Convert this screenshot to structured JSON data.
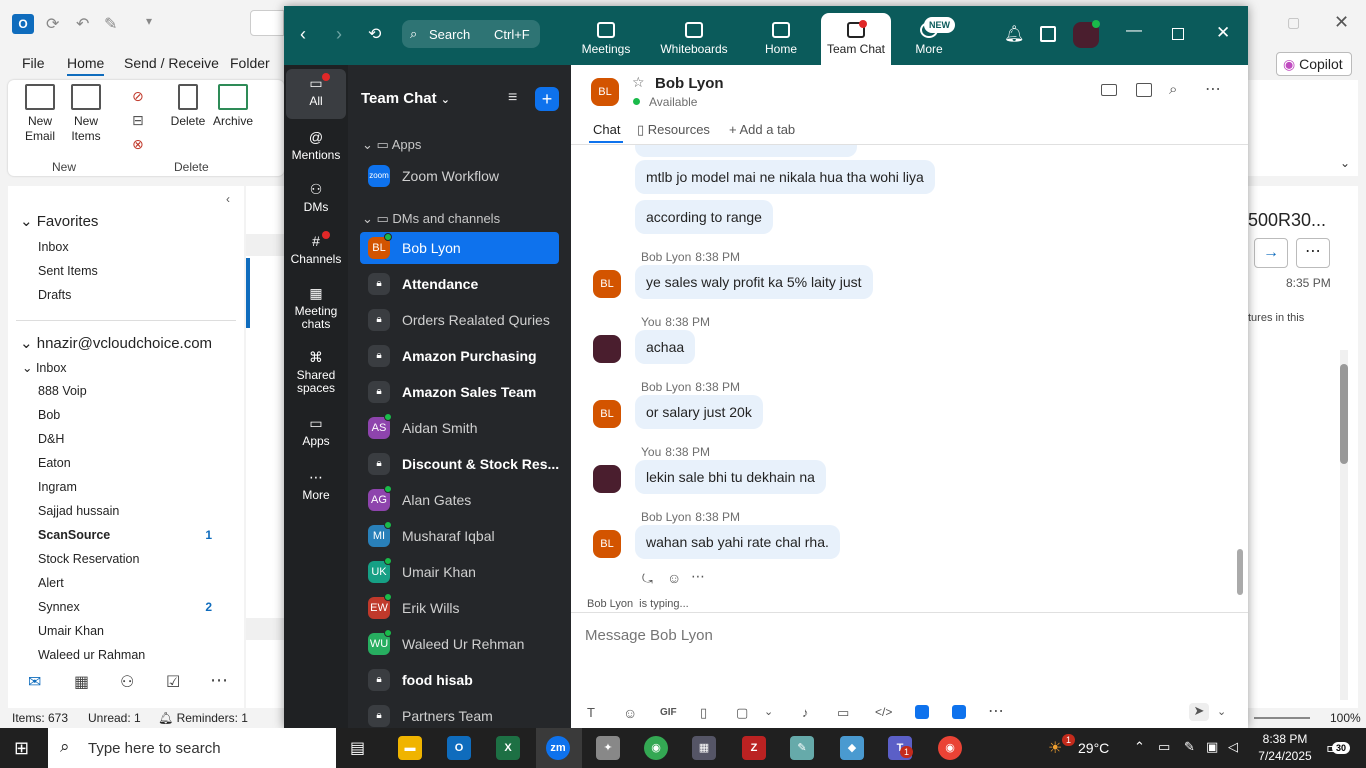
{
  "outlook": {
    "menu": [
      "File",
      "Home",
      "Send / Receive",
      "Folder"
    ],
    "ribbon": {
      "new_email": "New Email",
      "new_items": "New Items",
      "delete": "Delete",
      "archive": "Archive",
      "group_new": "New",
      "group_delete": "Delete"
    },
    "favorites_label": "Favorites",
    "favorites": [
      "Inbox",
      "Sent Items",
      "Drafts"
    ],
    "account": "hnazir@vcloudchoice.com",
    "inbox_label": "Inbox",
    "folders": [
      {
        "name": "888 Voip",
        "count": ""
      },
      {
        "name": "Bob",
        "count": ""
      },
      {
        "name": "D&H",
        "count": ""
      },
      {
        "name": "Eaton",
        "count": ""
      },
      {
        "name": "Ingram",
        "count": ""
      },
      {
        "name": "Sajjad hussain",
        "count": ""
      },
      {
        "name": "ScanSource",
        "count": "1"
      },
      {
        "name": "Stock Reservation",
        "count": ""
      },
      {
        "name": "Alert",
        "count": ""
      },
      {
        "name": "Synnex",
        "count": "2"
      },
      {
        "name": "Umair Khan",
        "count": ""
      },
      {
        "name": "Waleed ur Rahman",
        "count": ""
      }
    ],
    "copilot": "Copilot",
    "reading_title": "500R30...",
    "reading_time": "8:35 PM",
    "reading_snippet": "tures in this",
    "status": {
      "items": "Items: 673",
      "unread": "Unread: 1",
      "reminders": "Reminders: 1",
      "zoom": "100%"
    }
  },
  "zoom": {
    "search_label": "Search",
    "search_shortcut": "Ctrl+F",
    "tabs": [
      {
        "label": "Meetings"
      },
      {
        "label": "Whiteboards"
      },
      {
        "label": "Home"
      },
      {
        "label": "Team Chat"
      },
      {
        "label": "More"
      }
    ],
    "new_badge": "NEW",
    "rail": [
      "All",
      "Mentions",
      "DMs",
      "Channels",
      "Meeting chats",
      "Shared spaces",
      "Apps",
      "More"
    ],
    "list_title": "Team Chat",
    "sections": {
      "apps": "Apps",
      "dms": "DMs and channels"
    },
    "zoom_workflow": "Zoom Workflow",
    "channels": [
      {
        "initials": "BL",
        "name": "Bob Lyon",
        "bold": false,
        "color": "#d35400",
        "lock": false,
        "online": true
      },
      {
        "initials": "",
        "name": "Attendance",
        "bold": true,
        "color": "",
        "lock": true,
        "online": false
      },
      {
        "initials": "",
        "name": "Orders Realated Quries",
        "bold": false,
        "color": "",
        "lock": true,
        "online": false
      },
      {
        "initials": "",
        "name": "Amazon Purchasing",
        "bold": true,
        "color": "",
        "lock": true,
        "online": false
      },
      {
        "initials": "",
        "name": "Amazon Sales Team",
        "bold": true,
        "color": "",
        "lock": true,
        "online": false
      },
      {
        "initials": "AS",
        "name": "Aidan Smith",
        "bold": false,
        "color": "#8e44ad",
        "lock": false,
        "online": true
      },
      {
        "initials": "",
        "name": "Discount & Stock Res...",
        "bold": true,
        "color": "",
        "lock": true,
        "online": false
      },
      {
        "initials": "AG",
        "name": "Alan Gates",
        "bold": false,
        "color": "#8e44ad",
        "lock": false,
        "online": true
      },
      {
        "initials": "MI",
        "name": "Musharaf Iqbal",
        "bold": false,
        "color": "#2980b9",
        "lock": false,
        "online": true
      },
      {
        "initials": "UK",
        "name": "Umair Khan",
        "bold": false,
        "color": "#16a085",
        "lock": false,
        "online": true
      },
      {
        "initials": "EW",
        "name": "Erik Wills",
        "bold": false,
        "color": "#c0392b",
        "lock": false,
        "online": true
      },
      {
        "initials": "WU",
        "name": "Waleed Ur Rehman",
        "bold": false,
        "color": "#27ae60",
        "lock": false,
        "online": true
      },
      {
        "initials": "",
        "name": "food hisab",
        "bold": true,
        "color": "",
        "lock": true,
        "online": false
      },
      {
        "initials": "",
        "name": "Partners Team",
        "bold": false,
        "color": "",
        "lock": true,
        "online": false
      }
    ],
    "chat": {
      "contact_initials": "BL",
      "contact_name": "Bob Lyon",
      "presence": "Available",
      "subtabs": {
        "chat": "Chat",
        "resources": "Resources",
        "add_tab": "Add a tab"
      },
      "messages": [
        {
          "text": "mtlb jo model mai ne nikala hua tha wohi liya",
          "sender": "",
          "time": "",
          "who": "bl"
        },
        {
          "text": "according to range",
          "sender": "",
          "time": "",
          "who": "bl"
        },
        {
          "text": "ye sales waly profit ka 5% laity just",
          "sender": "Bob Lyon",
          "time": "8:38 PM",
          "who": "bl"
        },
        {
          "text": "achaa",
          "sender": "You",
          "time": "8:38 PM",
          "who": "you"
        },
        {
          "text": "or salary just 20k",
          "sender": "Bob Lyon",
          "time": "8:38 PM",
          "who": "bl"
        },
        {
          "text": "lekin sale bhi tu dekhain na",
          "sender": "You",
          "time": "8:38 PM",
          "who": "you"
        },
        {
          "text": "wahan sab yahi rate chal rha.",
          "sender": "Bob Lyon",
          "time": "8:38 PM",
          "who": "bl"
        }
      ],
      "typing": "Bob Lyon  is typing...",
      "composer_placeholder": "Message Bob Lyon",
      "gif_label": "GIF"
    }
  },
  "taskbar": {
    "search_placeholder": "Type here to search",
    "temperature": "29°C",
    "time": "8:38 PM",
    "date": "7/24/2025",
    "notif_count": "30",
    "weather_badge": "1",
    "teams_badge": "1"
  }
}
